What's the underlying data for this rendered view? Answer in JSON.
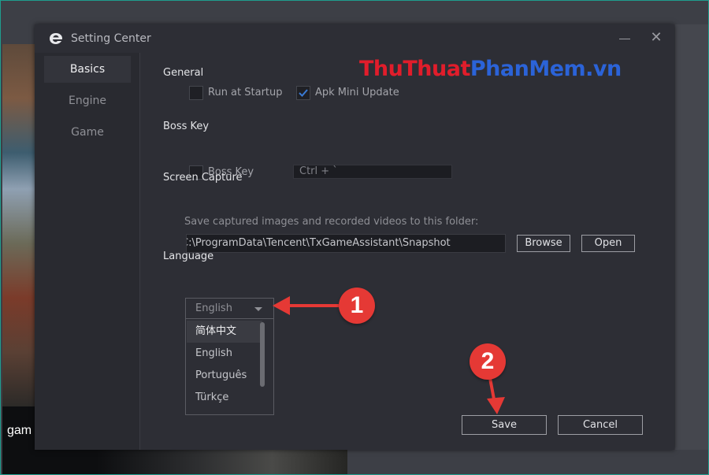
{
  "background": {
    "card_text": "gam"
  },
  "dialog": {
    "title": "Setting Center",
    "close_glyph": "✕"
  },
  "sidebar": {
    "items": [
      {
        "label": "Basics"
      },
      {
        "label": "Engine"
      },
      {
        "label": "Game"
      }
    ],
    "active": "Basics"
  },
  "general": {
    "title": "General",
    "run_at_startup": {
      "label": "Run at Startup",
      "checked": false
    },
    "apk_mini_update": {
      "label": "Apk Mini Update",
      "checked": true
    }
  },
  "boss_key": {
    "title": "Boss Key",
    "checkbox": {
      "label": "Boss Key",
      "checked": false
    },
    "shortcut_value": "Ctrl + `"
  },
  "screen_capture": {
    "title": "Screen Capture",
    "hint": "Save captured images and recorded videos to this folder:",
    "path_value": "C:\\ProgramData\\Tencent\\TxGameAssistant\\Snapshot",
    "browse_label": "Browse",
    "open_label": "Open"
  },
  "language": {
    "title": "Language",
    "selected": "English",
    "options": [
      "简体中文",
      "English",
      "Português",
      "Türkçe"
    ],
    "highlighted": "简体中文"
  },
  "footer": {
    "save_label": "Save",
    "cancel_label": "Cancel"
  },
  "watermark": {
    "part_a": "Thu",
    "part_b": "Thuat",
    "part_c": "Phan",
    "part_d": "Mem",
    "part_e": ".vn"
  },
  "annotations": {
    "marker_1": "1",
    "marker_2": "2"
  },
  "colors": {
    "accent_check": "#3a7bd5",
    "annotation_red": "#e53935",
    "dialog_bg": "#2d2e35"
  }
}
